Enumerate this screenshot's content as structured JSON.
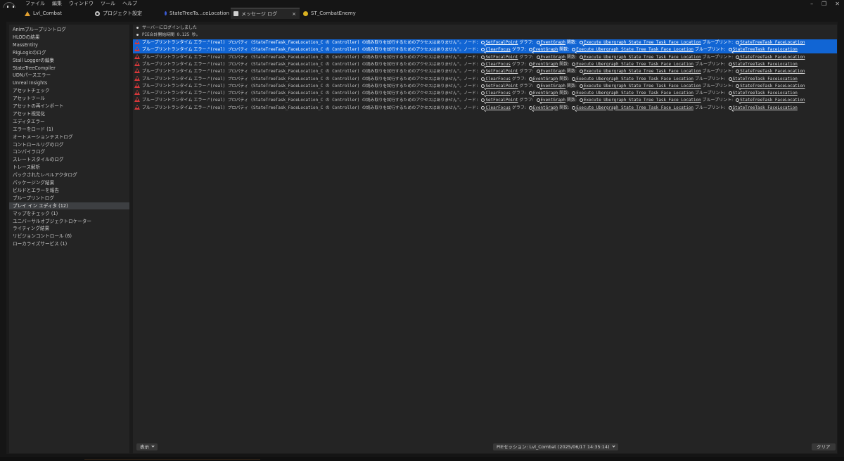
{
  "menubar": [
    "ファイル",
    "編集",
    "ウィンドウ",
    "ツール",
    "ヘルプ"
  ],
  "window_controls": [
    "–",
    "❐",
    "✕"
  ],
  "tabs": [
    {
      "label": "Lvl_Combat",
      "icon": "level-icon",
      "color": "#e0a030"
    },
    {
      "label": "プロジェクト設定",
      "icon": "gear-icon",
      "color": "#c8c8c8"
    },
    {
      "label": "StateTreeTa...ceLocation",
      "icon": "statetree-icon",
      "color": "#3b5bd6"
    },
    {
      "label": "メッセージ ログ",
      "icon": "message-log-icon",
      "color": "#d0d0d0",
      "close": "×"
    },
    {
      "label": "ST_CombatEnemy",
      "icon": "statetree-asset-icon",
      "color": "#d8b020"
    }
  ],
  "categories": [
    "Animブループリントログ",
    "HLODの結果",
    "MassEntity",
    "RigLogicのログ",
    "Stall Loggerの編集",
    "StateTreeCompiler",
    "UDNパースエラー",
    "Unreal Insights",
    "アセットチェック",
    "アセットツール",
    "アセットの再インポート",
    "アセット視覚化",
    "エディタエラー",
    "エラーをロード (1)",
    "オートメーションテストログ",
    "コントロールリグのログ",
    "コンパイラログ",
    "スレートスタイルのログ",
    "トレース解析",
    "パックされたレベルアクタログ",
    "パッケージング結果",
    "ビルドとエラーを報告",
    "ブループリントログ",
    "プレイ イン エディタ (12)",
    "マップをチェック (1)",
    "ユニバーサルオブジェクトロケーター",
    "ライティング結果",
    "リビジョンコントロール (6)",
    "ローカライズサービス (1)"
  ],
  "selected_category": 23,
  "info_lines": [
    "サーバーにログインしました",
    "PIE合計開始時間 0.125 秒。"
  ],
  "error_text": {
    "prefix": "ブループリントランタイム エラー:",
    "body": "\"(real) プロパティ (StateTreeTask_FaceLocation_C の Controller) の読み取りを試行するためのアクセスはありません\"。ノード:",
    "graph_label": "グラフ:",
    "function_label": "関数:",
    "blueprint_label": "ブループリント:",
    "graph": "EventGraph",
    "function": "Execute Ubergraph State Tree Task Face Location",
    "blueprint": "StateTreeTask_FaceLocation"
  },
  "error_rows": [
    {
      "node": "SetFocalPoint",
      "selected": true
    },
    {
      "node": "ClearFocus",
      "selected": true
    },
    {
      "node": "SetFocalPoint",
      "selected": false
    },
    {
      "node": "ClearFocus",
      "selected": false
    },
    {
      "node": "SetFocalPoint",
      "selected": false
    },
    {
      "node": "ClearFocus",
      "selected": false
    },
    {
      "node": "SetFocalPoint",
      "selected": false
    },
    {
      "node": "ClearFocus",
      "selected": false
    },
    {
      "node": "SetFocalPoint",
      "selected": false
    },
    {
      "node": "ClearFocus",
      "selected": false
    }
  ],
  "bottom": {
    "view_label": "表示",
    "session_label": "PIEセッション: Lvl_Combat (2025/06/17 14:35:14)",
    "clear_label": "クリア"
  },
  "colors": {
    "selection": "#1165d4",
    "error_icon": "#d9383a",
    "panel": "#242424",
    "background": "#151515"
  }
}
